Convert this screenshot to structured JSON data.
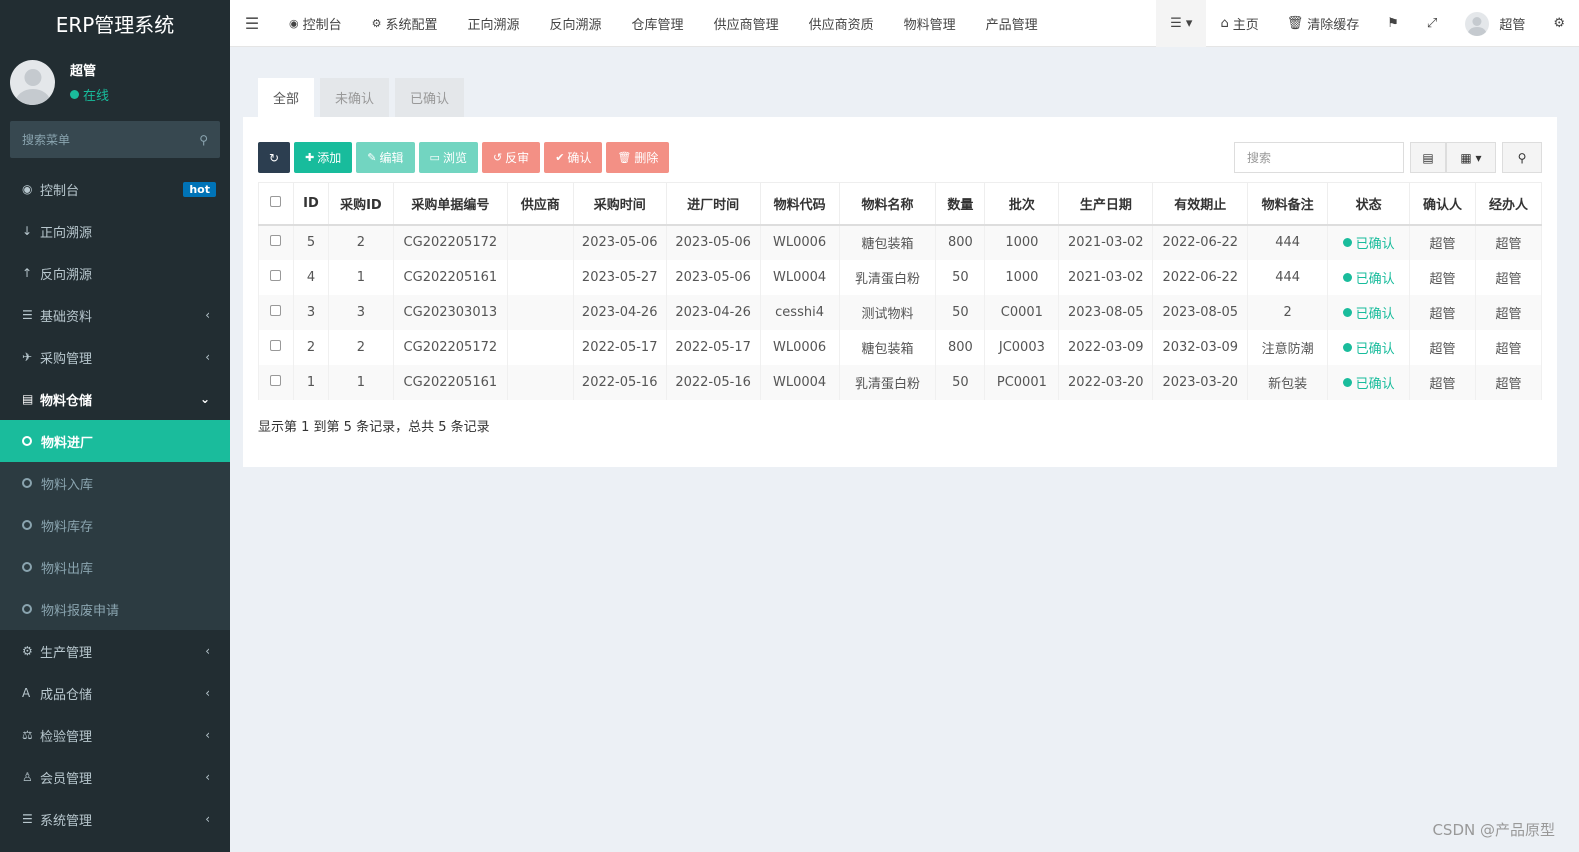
{
  "app": {
    "title": "ERP管理系统"
  },
  "user": {
    "name": "超管",
    "status": "在线"
  },
  "sidebar": {
    "search_placeholder": "搜索菜单",
    "items": [
      {
        "label": "控制台",
        "icon": "dashboard-icon",
        "badge": "hot"
      },
      {
        "label": "正向溯源",
        "icon": "arrow-down-icon"
      },
      {
        "label": "反向溯源",
        "icon": "arrow-up-icon"
      },
      {
        "label": "基础资料",
        "icon": "list-icon"
      },
      {
        "label": "采购管理",
        "icon": "plane-icon"
      },
      {
        "label": "物料仓储",
        "icon": "database-icon"
      }
    ],
    "submenu": [
      "物料进厂",
      "物料入库",
      "物料库存",
      "物料出库",
      "物料报废申请"
    ],
    "items_after": [
      {
        "label": "生产管理",
        "icon": "gears-icon"
      },
      {
        "label": "成品仓储",
        "icon": "font-icon"
      },
      {
        "label": "检验管理",
        "icon": "balance-icon"
      },
      {
        "label": "会员管理",
        "icon": "user-icon"
      },
      {
        "label": "系统管理",
        "icon": "list-icon"
      }
    ]
  },
  "topnav": [
    "控制台",
    "系统配置",
    "正向溯源",
    "反向溯源",
    "仓库管理",
    "供应商管理",
    "供应商资质",
    "物料管理",
    "产品管理"
  ],
  "topright": {
    "home": "主页",
    "clear_cache": "清除缓存",
    "user": "超管"
  },
  "tabs": [
    "全部",
    "未确认",
    "已确认"
  ],
  "toolbar": {
    "add": "添加",
    "edit": "编辑",
    "browse": "浏览",
    "reverse": "反审",
    "confirm": "确认",
    "delete": "删除"
  },
  "search": {
    "placeholder": "搜索"
  },
  "table": {
    "headers": [
      "ID",
      "采购ID",
      "采购单据编号",
      "供应商",
      "采购时间",
      "进厂时间",
      "物料代码",
      "物料名称",
      "数量",
      "批次",
      "生产日期",
      "有效期止",
      "物料备注",
      "状态",
      "确认人",
      "经办人"
    ],
    "rows": [
      [
        "5",
        "2",
        "CG202205172",
        "",
        "2023-05-06",
        "2023-05-06",
        "WL0006",
        "糖包装箱",
        "800",
        "1000",
        "2021-03-02",
        "2022-06-22",
        "444",
        "已确认",
        "超管",
        "超管"
      ],
      [
        "4",
        "1",
        "CG202205161",
        "",
        "2023-05-27",
        "2023-05-06",
        "WL0004",
        "乳清蛋白粉",
        "50",
        "1000",
        "2021-03-02",
        "2022-06-22",
        "444",
        "已确认",
        "超管",
        "超管"
      ],
      [
        "3",
        "3",
        "CG202303013",
        "",
        "2023-04-26",
        "2023-04-26",
        "cesshi4",
        "测试物料",
        "50",
        "C0001",
        "2023-08-05",
        "2023-08-05",
        "2",
        "已确认",
        "超管",
        "超管"
      ],
      [
        "2",
        "2",
        "CG202205172",
        "",
        "2022-05-17",
        "2022-05-17",
        "WL0006",
        "糖包装箱",
        "800",
        "JC0003",
        "2022-03-09",
        "2032-03-09",
        "注意防潮",
        "已确认",
        "超管",
        "超管"
      ],
      [
        "1",
        "1",
        "CG202205161",
        "",
        "2022-05-16",
        "2022-05-16",
        "WL0004",
        "乳清蛋白粉",
        "50",
        "PC0001",
        "2022-03-20",
        "2023-03-20",
        "新包装",
        "已确认",
        "超管",
        "超管"
      ]
    ]
  },
  "summary": "显示第 1 到第 5 条记录，总共 5 条记录",
  "watermark": "CSDN @产品原型",
  "colors": {
    "accent": "#18bc9c",
    "sidebar": "#222d32",
    "danger_light": "#f39085"
  }
}
